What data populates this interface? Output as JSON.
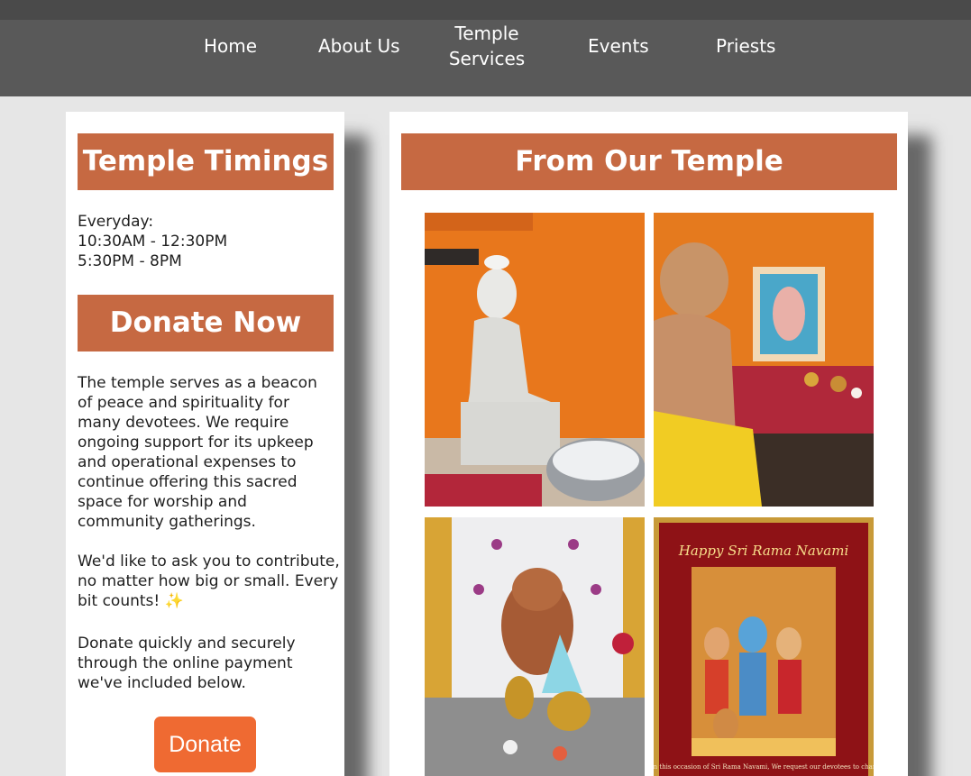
{
  "nav": {
    "items": [
      {
        "label": "Home"
      },
      {
        "label": "About Us"
      },
      {
        "label": "Temple Services"
      },
      {
        "label": "Events"
      },
      {
        "label": "Priests"
      }
    ]
  },
  "sidebar": {
    "timings_title": "Temple Timings",
    "timings": [
      "Everyday:",
      "10:30AM - 12:30PM",
      "5:30PM - 8PM"
    ],
    "donate_title": "Donate Now",
    "paragraphs": [
      "The temple serves as a beacon of peace and spirituality for many devotees. We require ongoing support for its upkeep and operational expenses to continue offering this sacred space for worship and community gatherings.",
      "We'd like to ask you to contribute, no matter how big or small. Every bit counts! ✨",
      "Donate quickly and securely through the online payment we've included below."
    ],
    "donate_button": "Donate"
  },
  "gallery": {
    "title": "From Our Temple",
    "photos": [
      {
        "name": "sai-baba-abhishekam-photo"
      },
      {
        "name": "priest-puja-photo"
      },
      {
        "name": "ganesha-decoration-photo"
      },
      {
        "name": "sri-rama-navami-poster",
        "caption": "Happy Sri Rama Navami",
        "footer": "On this occasion of Sri Rama Navami, We request our devotees to chant"
      }
    ]
  },
  "colors": {
    "banner": "#c66942",
    "donate_button": "#ef6a32",
    "navbar": "#595959"
  }
}
